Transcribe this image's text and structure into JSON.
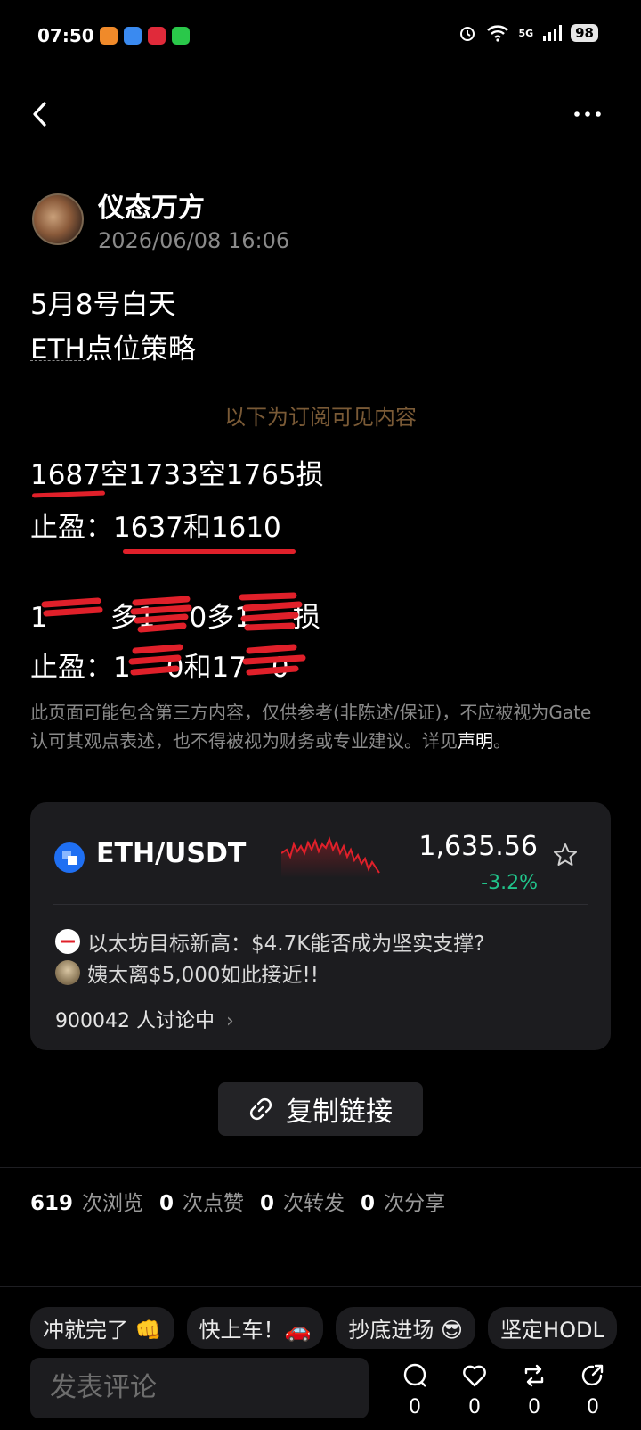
{
  "status_bar": {
    "time": "07:50",
    "battery": "98",
    "network": "5G"
  },
  "header": {
    "back_icon": "chevron-left-icon",
    "more_icon": "more-horizontal-icon"
  },
  "post": {
    "author": "仪态万方",
    "time": "2026/06/08 16:06",
    "lines": [
      "5月8号白天",
      "ETH点位策略"
    ],
    "subscriber_divider": "以下为订阅可见内容",
    "strategy": {
      "short_line": "1687空1733空1765损",
      "short_tp": "止盈：1637和1610",
      "long_line_prefix": "1",
      "long_line_mid": "多1",
      "long_line_mid2": "0多1",
      "long_line_suffix": "损",
      "long_tp_prefix": "止盈：1",
      "long_tp_mid": "0和17",
      "long_tp_suffix": "0"
    },
    "disclaimer": "此页面可能包含第三方内容，仅供参考(非陈述/保证)，不应被视为Gate认可其观点表述，也不得被视为财务或专业建议。详见",
    "disclaimer_link": "声明",
    "disclaimer_end": "。"
  },
  "ticker": {
    "pair": "ETH/USDT",
    "price": "1,635.56",
    "change": "-3.2%",
    "change_color": "#21c38a",
    "news": [
      {
        "text": "以太坊目标新高：$4.7K能否成为坚实支撑?"
      },
      {
        "text": "姨太离$5,000如此接近!!"
      }
    ],
    "discuss": "900042 人讨论中"
  },
  "copy_link": "复制链接",
  "stats": {
    "views": "619",
    "views_label": "次浏览",
    "likes": "0",
    "likes_label": "次点赞",
    "reposts": "0",
    "reposts_label": "次转发",
    "shares": "0",
    "shares_label": "次分享"
  },
  "chips": [
    "冲就完了 👊",
    "快上车！🚗",
    "抄底进场 😎",
    "坚定HODL"
  ],
  "comment_placeholder": "发表评论",
  "actions": {
    "comments": "0",
    "likes": "0",
    "reposts": "0",
    "shares": "0"
  },
  "accent": "#e0202a"
}
